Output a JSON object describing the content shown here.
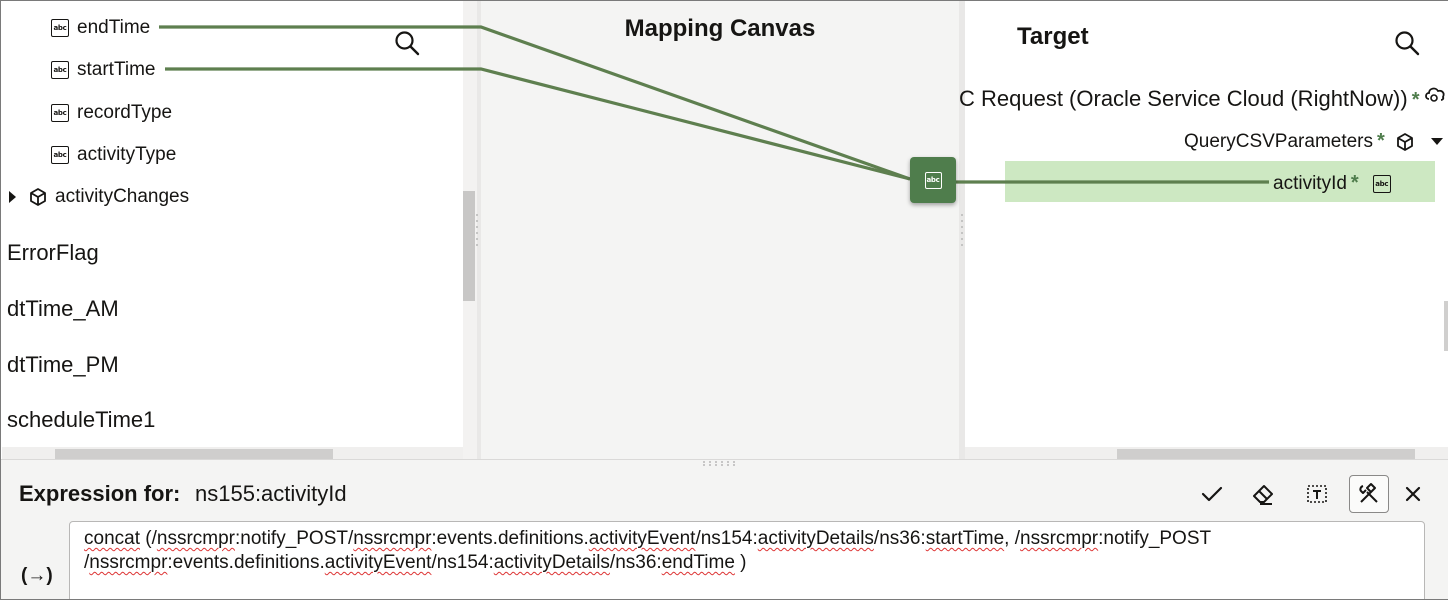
{
  "source": {
    "fields": [
      {
        "label": "endTime",
        "icon": "abc-icon"
      },
      {
        "label": "startTime",
        "icon": "abc-icon"
      },
      {
        "label": "recordType",
        "icon": "abc-icon"
      },
      {
        "label": "activityType",
        "icon": "abc-icon"
      }
    ],
    "collapsed_group": {
      "label": "activityChanges",
      "icon": "cube-icon",
      "expand_icon": "caret-right-icon"
    },
    "variables": [
      "ErrorFlag",
      "dtTime_AM",
      "dtTime_PM",
      "scheduleTime1"
    ],
    "search_icon": "search-icon"
  },
  "canvas": {
    "title": "Mapping Canvas",
    "function_node": {
      "icon": "abc-icon",
      "color": "#4f7d4c"
    },
    "line_color": "#5e7f4f"
  },
  "target": {
    "title": "Target",
    "root_label": "C Request (Oracle Service Cloud (RightNow))",
    "root_required": "*",
    "root_icon": "cloud-icon",
    "param_label": "QueryCSVParameters",
    "param_required": "*",
    "param_icon": "cube-icon",
    "field_label": "activityId",
    "field_required": "*",
    "field_icon": "abc-icon",
    "highlight_color": "#cde8c2",
    "search_icon": "search-icon"
  },
  "expression": {
    "label": "Expression for:",
    "target_name": "ns155:activityId",
    "toolbar": [
      "check-icon",
      "eraser-icon",
      "text-frame-icon",
      "tools-icon",
      "close-icon"
    ],
    "function_toggle": "(→)",
    "segments": [
      {
        "t": "concat",
        "sq": true
      },
      {
        "t": " (/",
        "sq": false
      },
      {
        "t": "nssrcmpr",
        "sq": true
      },
      {
        "t": ":notify_POST/",
        "sq": false
      },
      {
        "t": "nssrcmpr",
        "sq": true
      },
      {
        "t": ":events.definitions.",
        "sq": false
      },
      {
        "t": "activityEvent",
        "sq": true
      },
      {
        "t": "/ns154:",
        "sq": false
      },
      {
        "t": "activityDetails",
        "sq": true
      },
      {
        "t": "/ns36:",
        "sq": false
      },
      {
        "t": "startTime",
        "sq": true
      },
      {
        "t": ", /",
        "sq": false
      },
      {
        "t": "nssrcmpr",
        "sq": true
      },
      {
        "t": ":notify_POST",
        "sq": false
      },
      {
        "br": true
      },
      {
        "t": "/",
        "sq": false
      },
      {
        "t": "nssrcmpr",
        "sq": true
      },
      {
        "t": ":events.definitions.",
        "sq": false
      },
      {
        "t": "activityEvent",
        "sq": true
      },
      {
        "t": "/ns154:",
        "sq": false
      },
      {
        "t": "activityDetails",
        "sq": true
      },
      {
        "t": "/ns36:",
        "sq": false
      },
      {
        "t": "endTime",
        "sq": true
      },
      {
        "t": " )",
        "sq": false
      }
    ]
  }
}
